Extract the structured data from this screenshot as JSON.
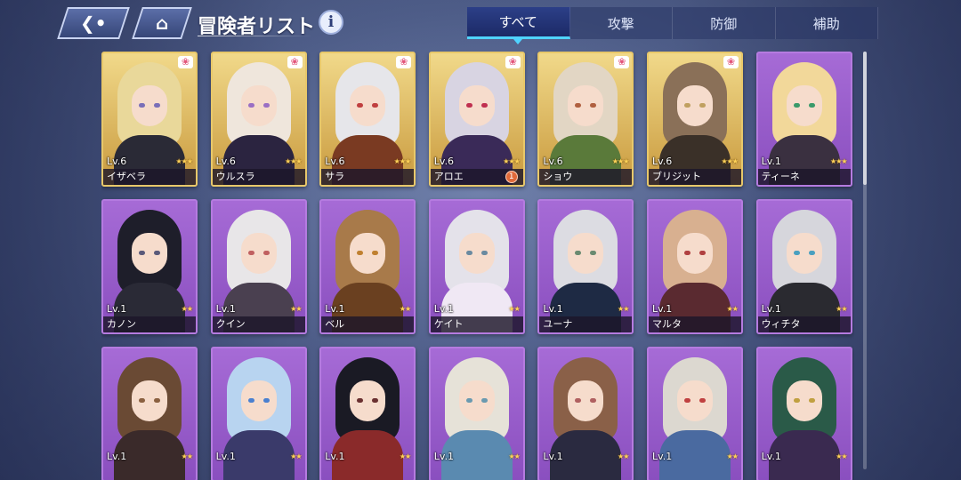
{
  "header": {
    "back_icon": "back-arrow-icon",
    "home_icon": "home-icon",
    "title": "冒険者リスト",
    "info_label": "i"
  },
  "tabs": [
    {
      "label": "すべて",
      "active": true
    },
    {
      "label": "攻撃",
      "active": false
    },
    {
      "label": "防御",
      "active": false
    },
    {
      "label": "補助",
      "active": false
    }
  ],
  "colors": {
    "gold_frame": "#e8c86a",
    "purple_frame": "#b57be0",
    "active_tab_accent": "#4fd3ff"
  },
  "characters": [
    {
      "name": "イザベラ",
      "level": "Lv.6",
      "stars": 3,
      "rarity": "gold",
      "paw": true,
      "badge": "",
      "hair": "#e9d89a",
      "outfit": "#2a2a36",
      "eye": "#7a6fb8"
    },
    {
      "name": "ウルスラ",
      "level": "Lv.6",
      "stars": 3,
      "rarity": "gold",
      "paw": true,
      "badge": "",
      "hair": "#efe6dc",
      "outfit": "#2b2440",
      "eye": "#9a6fc4"
    },
    {
      "name": "サラ",
      "level": "Lv.6",
      "stars": 3,
      "rarity": "gold",
      "paw": true,
      "badge": "",
      "hair": "#e6e6ea",
      "outfit": "#7a3a22",
      "eye": "#c04040"
    },
    {
      "name": "アロエ",
      "level": "Lv.6",
      "stars": 3,
      "rarity": "gold",
      "paw": true,
      "badge": "1",
      "hair": "#d8d4e2",
      "outfit": "#3a2a58",
      "eye": "#c03050"
    },
    {
      "name": "ショウ",
      "level": "Lv.6",
      "stars": 3,
      "rarity": "gold",
      "paw": true,
      "badge": "",
      "hair": "#e2d6c4",
      "outfit": "#5a7a3a",
      "eye": "#b06040"
    },
    {
      "name": "ブリジット",
      "level": "Lv.6",
      "stars": 3,
      "rarity": "gold",
      "paw": true,
      "badge": "",
      "hair": "#8a7058",
      "outfit": "#3a3028",
      "eye": "#c0a060"
    },
    {
      "name": "ティーネ",
      "level": "Lv.1",
      "stars": 3,
      "rarity": "purple",
      "paw": false,
      "badge": "",
      "hair": "#f2d89a",
      "outfit": "#3a3040",
      "eye": "#3a9a6a"
    },
    {
      "name": "カノン",
      "level": "Lv.1",
      "stars": 2,
      "rarity": "purple",
      "paw": false,
      "badge": "",
      "hair": "#1e1e2a",
      "outfit": "#2a2a36",
      "eye": "#5a5a7a"
    },
    {
      "name": "クイン",
      "level": "Lv.1",
      "stars": 2,
      "rarity": "purple",
      "paw": false,
      "badge": "",
      "hair": "#e8e6e8",
      "outfit": "#4a4050",
      "eye": "#c06060"
    },
    {
      "name": "ベル",
      "level": "Lv.1",
      "stars": 2,
      "rarity": "purple",
      "paw": false,
      "badge": "",
      "hair": "#a87a4a",
      "outfit": "#6a4020",
      "eye": "#c08030"
    },
    {
      "name": "ケイト",
      "level": "Lv.1",
      "stars": 2,
      "rarity": "purple",
      "paw": false,
      "badge": "",
      "hair": "#e4e2ea",
      "outfit": "#f0e8f4",
      "eye": "#6a8aa0"
    },
    {
      "name": "ユーナ",
      "level": "Lv.1",
      "stars": 2,
      "rarity": "purple",
      "paw": false,
      "badge": "",
      "hair": "#dcdce2",
      "outfit": "#1e2a44",
      "eye": "#6a8a70"
    },
    {
      "name": "マルタ",
      "level": "Lv.1",
      "stars": 2,
      "rarity": "purple",
      "paw": false,
      "badge": "",
      "hair": "#d8b090",
      "outfit": "#5a2a30",
      "eye": "#b04040"
    },
    {
      "name": "ウィチタ",
      "level": "Lv.1",
      "stars": 2,
      "rarity": "purple",
      "paw": false,
      "badge": "",
      "hair": "#d6d6dc",
      "outfit": "#2a2a30",
      "eye": "#4aa0c0"
    },
    {
      "name": "",
      "level": "Lv.1",
      "stars": 2,
      "rarity": "purple",
      "paw": false,
      "badge": "",
      "hair": "#6a4a34",
      "outfit": "#3a2a2a",
      "eye": "#8a6040"
    },
    {
      "name": "",
      "level": "Lv.1",
      "stars": 2,
      "rarity": "purple",
      "paw": false,
      "badge": "",
      "hair": "#b8d4f0",
      "outfit": "#3a3a6a",
      "eye": "#4a80d0"
    },
    {
      "name": "",
      "level": "Lv.1",
      "stars": 2,
      "rarity": "purple",
      "paw": false,
      "badge": "",
      "hair": "#1a1a24",
      "outfit": "#8a2a2a",
      "eye": "#6a3030"
    },
    {
      "name": "",
      "level": "Lv.1",
      "stars": 2,
      "rarity": "purple",
      "paw": false,
      "badge": "",
      "hair": "#e6e2d8",
      "outfit": "#5a8ab0",
      "eye": "#6a9ab0"
    },
    {
      "name": "",
      "level": "Lv.1",
      "stars": 2,
      "rarity": "purple",
      "paw": false,
      "badge": "",
      "hair": "#8a6048",
      "outfit": "#2a2a40",
      "eye": "#b06060"
    },
    {
      "name": "",
      "level": "Lv.1",
      "stars": 2,
      "rarity": "purple",
      "paw": false,
      "badge": "",
      "hair": "#dcd8d0",
      "outfit": "#4a6aa0",
      "eye": "#c04040"
    },
    {
      "name": "",
      "level": "Lv.1",
      "stars": 2,
      "rarity": "purple",
      "paw": false,
      "badge": "",
      "hair": "#2a5a48",
      "outfit": "#3a2a50",
      "eye": "#c0a040"
    }
  ]
}
